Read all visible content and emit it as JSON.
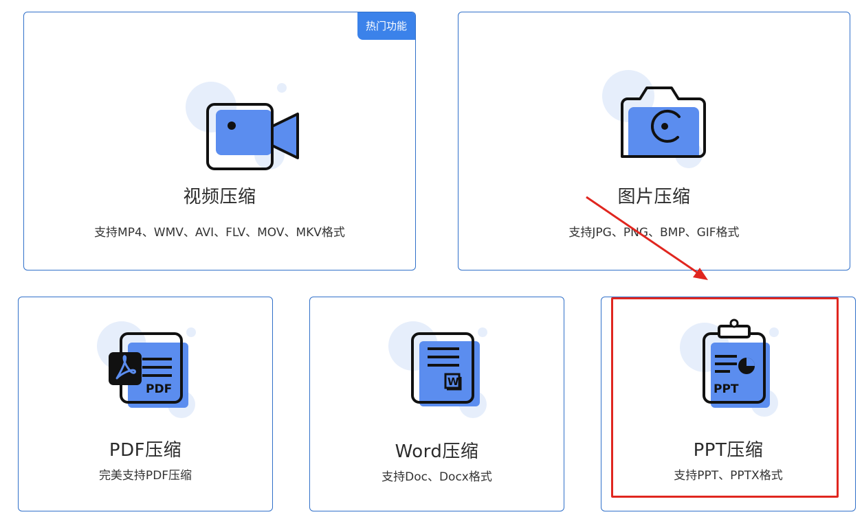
{
  "cards": {
    "video": {
      "title": "视频压缩",
      "desc": "支持MP4、WMV、AVI、FLV、MOV、MKV格式",
      "badge": "热门功能"
    },
    "image": {
      "title": "图片压缩",
      "desc": "支持JPG、PNG、BMP、GIF格式"
    },
    "pdf": {
      "title": "PDF压缩",
      "desc": "完美支持PDF压缩",
      "icon_text": "PDF"
    },
    "word": {
      "title": "Word压缩",
      "desc": "支持Doc、Docx格式",
      "icon_text": "W"
    },
    "ppt": {
      "title": "PPT压缩",
      "desc": "支持PPT、PPTX格式",
      "icon_text": "PPT"
    }
  },
  "colors": {
    "accent": "#5b8def",
    "border": "#2f6fc9",
    "badge": "#3b82ea",
    "highlight": "#e0261f",
    "bubble": "#e6eefb"
  },
  "icons": {
    "video": "video-camera-icon",
    "image": "camera-icon",
    "pdf": "pdf-document-icon",
    "word": "word-document-icon",
    "ppt": "ppt-clipboard-icon"
  }
}
